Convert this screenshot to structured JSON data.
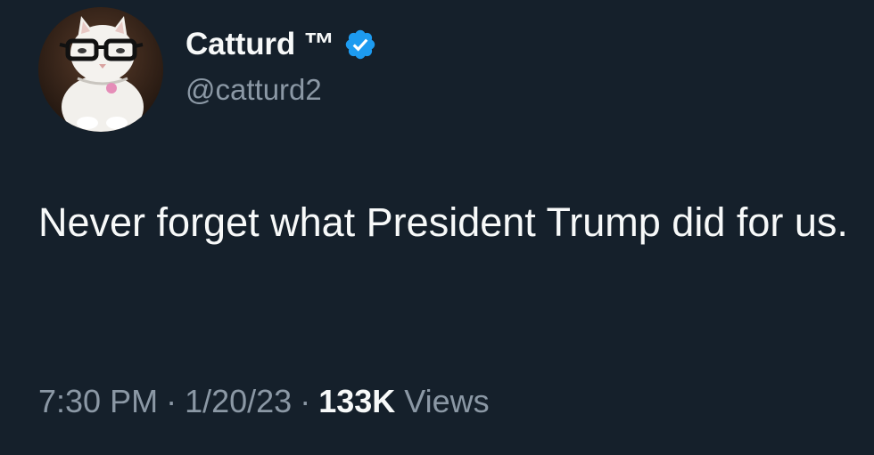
{
  "author": {
    "display_name": "Catturd ™",
    "handle": "@catturd2",
    "verified": true,
    "avatar": "cat-with-glasses-avatar"
  },
  "tweet": {
    "text": "Never forget what President Trump did for us."
  },
  "meta": {
    "time": "7:30 PM",
    "separator": "·",
    "date": "1/20/23",
    "views_count": "133K",
    "views_label": "Views"
  },
  "colors": {
    "background": "#15202b",
    "primary_text": "#f7f9f9",
    "secondary_text": "#8b98a5",
    "verified_badge": "#1d9bf0"
  }
}
